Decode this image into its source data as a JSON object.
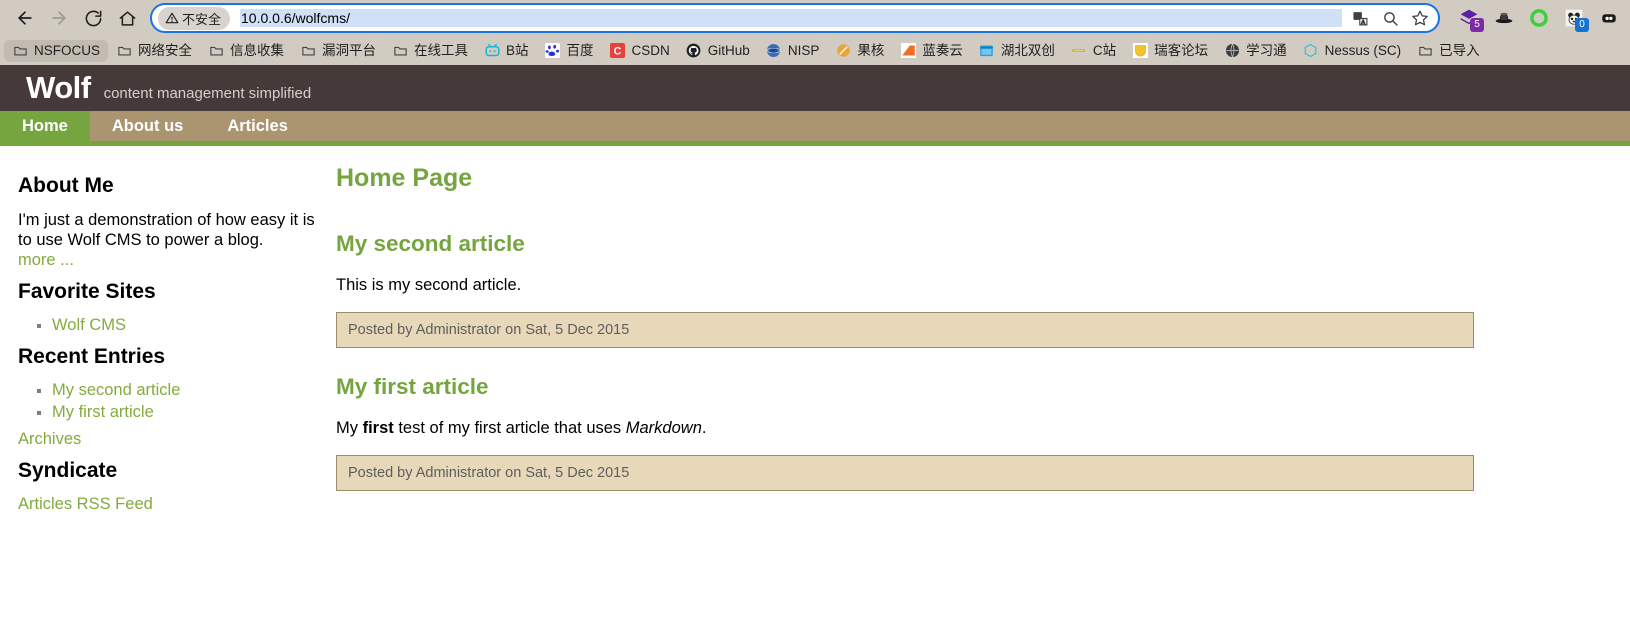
{
  "browser": {
    "nav": {
      "back_tooltip": "Back",
      "forward_tooltip": "Forward",
      "reload_tooltip": "Reload",
      "home_tooltip": "Home"
    },
    "omnibox": {
      "security_label": "不安全",
      "url": "10.0.0.6/wolfcms/",
      "icons": [
        "translate-icon",
        "zoom-icon",
        "bookmark-star-icon"
      ]
    },
    "extensions": [
      {
        "name": "layers-extension-icon",
        "badge": "5",
        "badge_color": "#7b2ba8"
      },
      {
        "name": "hat-extension-icon",
        "badge": "",
        "badge_color": ""
      },
      {
        "name": "green-ring-extension-icon",
        "badge": "",
        "badge_color": ""
      },
      {
        "name": "panda-extension-icon",
        "badge": "0",
        "badge_color": "#1573d6"
      },
      {
        "name": "dark-eyes-extension-icon",
        "badge": "",
        "badge_color": ""
      }
    ],
    "bookmarks": [
      {
        "label": "NSFOCUS",
        "icon": "folder-icon",
        "highlighted": true
      },
      {
        "label": "网络安全",
        "icon": "folder-icon",
        "highlighted": false
      },
      {
        "label": "信息收集",
        "icon": "folder-icon",
        "highlighted": false
      },
      {
        "label": "漏洞平台",
        "icon": "folder-icon",
        "highlighted": false
      },
      {
        "label": "在线工具",
        "icon": "folder-icon",
        "highlighted": false
      },
      {
        "label": "B站",
        "icon": "bilibili-icon",
        "highlighted": false
      },
      {
        "label": "百度",
        "icon": "baidu-icon",
        "highlighted": false
      },
      {
        "label": "CSDN",
        "icon": "csdn-icon",
        "highlighted": false
      },
      {
        "label": "GitHub",
        "icon": "github-icon",
        "highlighted": false
      },
      {
        "label": "NISP",
        "icon": "nisp-icon",
        "highlighted": false
      },
      {
        "label": "果核",
        "icon": "guohe-icon",
        "highlighted": false
      },
      {
        "label": "蓝奏云",
        "icon": "lanzou-icon",
        "highlighted": false
      },
      {
        "label": "湖北双创",
        "icon": "hubei-icon",
        "highlighted": false
      },
      {
        "label": "C站",
        "icon": "czhan-icon",
        "highlighted": false
      },
      {
        "label": "瑞客论坛",
        "icon": "ruike-icon",
        "highlighted": false
      },
      {
        "label": "学习通",
        "icon": "xuexitong-icon",
        "highlighted": false
      },
      {
        "label": "Nessus (SC)",
        "icon": "nessus-icon",
        "highlighted": false
      },
      {
        "label": "已导入",
        "icon": "folder-icon",
        "highlighted": false
      }
    ]
  },
  "site": {
    "title": "Wolf",
    "tagline": "content management simplified",
    "nav": [
      {
        "label": "Home",
        "active": true
      },
      {
        "label": "About us",
        "active": false
      },
      {
        "label": "Articles",
        "active": false
      }
    ]
  },
  "sidebar": {
    "about": {
      "heading": "About Me",
      "text": "I'm just a demonstration of how easy it is to use Wolf CMS to power a blog.",
      "more_label": "more ..."
    },
    "favorites": {
      "heading": "Favorite Sites",
      "items": [
        {
          "label": "Wolf CMS"
        }
      ]
    },
    "recent": {
      "heading": "Recent Entries",
      "items": [
        {
          "label": "My second article"
        },
        {
          "label": "My first article"
        }
      ],
      "archives_label": "Archives"
    },
    "syndicate": {
      "heading": "Syndicate",
      "feed_label": "Articles RSS Feed"
    }
  },
  "main": {
    "page_title": "Home Page",
    "articles": [
      {
        "title": "My second article",
        "body_plain": "This is my second article.",
        "meta": "Posted by Administrator on Sat, 5 Dec 2015"
      },
      {
        "title": "My first article",
        "body_prefix": "My ",
        "body_bold": "first",
        "body_middle": " test of my first article that uses ",
        "body_italic": "Markdown",
        "body_suffix": ".",
        "meta": "Posted by Administrator on Sat, 5 Dec 2015"
      }
    ]
  },
  "colors": {
    "header_bg": "#46393a",
    "nav_bg": "#ab9470",
    "accent_green": "#76a540",
    "link_green": "#84ab3d",
    "meta_bg": "#e8d8ba",
    "meta_border": "#9c8c6a",
    "chrome_bg": "#d2cbc2",
    "omnibox_focus": "#1a73e8"
  }
}
